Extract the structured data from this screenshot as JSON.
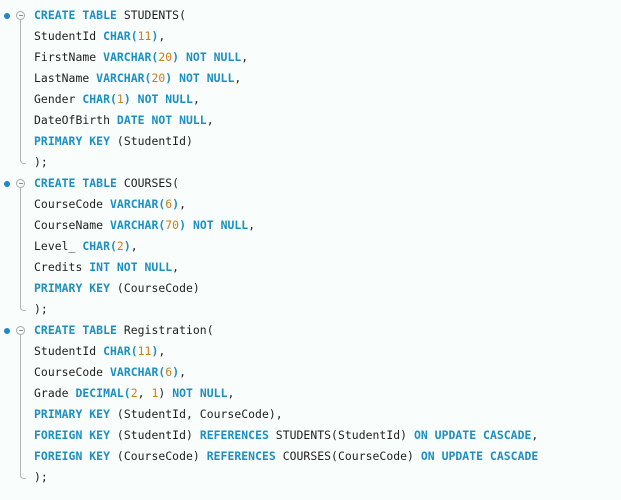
{
  "editor": {
    "language": "SQL",
    "colors": {
      "keyword": "#1b8fc1",
      "number": "#c77d1c",
      "identifier": "#1e1e1e",
      "background": "#f9fefd",
      "breakpoint_dot": "#1f86c9"
    },
    "blocks": [
      {
        "name": "students",
        "lines": [
          [
            {
              "t": "kw",
              "v": "CREATE TABLE"
            },
            {
              "t": "id",
              "v": " STUDENTS("
            }
          ],
          [
            {
              "t": "id",
              "v": "StudentId "
            },
            {
              "t": "kw",
              "v": "CHAR("
            },
            {
              "t": "num",
              "v": "11"
            },
            {
              "t": "kw",
              "v": ")"
            },
            {
              "t": "id",
              "v": ","
            }
          ],
          [
            {
              "t": "id",
              "v": "FirstName "
            },
            {
              "t": "kw",
              "v": "VARCHAR("
            },
            {
              "t": "num",
              "v": "20"
            },
            {
              "t": "kw",
              "v": ")"
            },
            {
              "t": "id",
              "v": " "
            },
            {
              "t": "kw",
              "v": "NOT NULL"
            },
            {
              "t": "id",
              "v": ","
            }
          ],
          [
            {
              "t": "id",
              "v": "LastName "
            },
            {
              "t": "kw",
              "v": "VARCHAR("
            },
            {
              "t": "num",
              "v": "20"
            },
            {
              "t": "kw",
              "v": ")"
            },
            {
              "t": "id",
              "v": " "
            },
            {
              "t": "kw",
              "v": "NOT NULL"
            },
            {
              "t": "id",
              "v": ","
            }
          ],
          [
            {
              "t": "id",
              "v": "Gender "
            },
            {
              "t": "kw",
              "v": "CHAR("
            },
            {
              "t": "num",
              "v": "1"
            },
            {
              "t": "kw",
              "v": ")"
            },
            {
              "t": "id",
              "v": " "
            },
            {
              "t": "kw",
              "v": "NOT NULL"
            },
            {
              "t": "id",
              "v": ","
            }
          ],
          [
            {
              "t": "id",
              "v": "DateOfBirth "
            },
            {
              "t": "kw",
              "v": "DATE NOT NULL"
            },
            {
              "t": "id",
              "v": ","
            }
          ],
          [
            {
              "t": "kw",
              "v": "PRIMARY KEY"
            },
            {
              "t": "id",
              "v": " (StudentId)"
            }
          ],
          [
            {
              "t": "id",
              "v": ");"
            }
          ]
        ]
      },
      {
        "name": "courses",
        "lines": [
          [
            {
              "t": "kw",
              "v": "CREATE TABLE"
            },
            {
              "t": "id",
              "v": " COURSES("
            }
          ],
          [
            {
              "t": "id",
              "v": "CourseCode "
            },
            {
              "t": "kw",
              "v": "VARCHAR("
            },
            {
              "t": "num",
              "v": "6"
            },
            {
              "t": "kw",
              "v": ")"
            },
            {
              "t": "id",
              "v": ","
            }
          ],
          [
            {
              "t": "id",
              "v": "CourseName "
            },
            {
              "t": "kw",
              "v": "VARCHAR("
            },
            {
              "t": "num",
              "v": "70"
            },
            {
              "t": "kw",
              "v": ")"
            },
            {
              "t": "id",
              "v": " "
            },
            {
              "t": "kw",
              "v": "NOT NULL"
            },
            {
              "t": "id",
              "v": ","
            }
          ],
          [
            {
              "t": "id",
              "v": "Level_ "
            },
            {
              "t": "kw",
              "v": "CHAR("
            },
            {
              "t": "num",
              "v": "2"
            },
            {
              "t": "kw",
              "v": ")"
            },
            {
              "t": "id",
              "v": ","
            }
          ],
          [
            {
              "t": "id",
              "v": "Credits "
            },
            {
              "t": "kw",
              "v": "INT NOT NULL"
            },
            {
              "t": "id",
              "v": ","
            }
          ],
          [
            {
              "t": "kw",
              "v": "PRIMARY KEY"
            },
            {
              "t": "id",
              "v": " (CourseCode)"
            }
          ],
          [
            {
              "t": "id",
              "v": ");"
            }
          ]
        ]
      },
      {
        "name": "registration",
        "lines": [
          [
            {
              "t": "kw",
              "v": "CREATE TABLE"
            },
            {
              "t": "id",
              "v": " Registration("
            }
          ],
          [
            {
              "t": "id",
              "v": "StudentId "
            },
            {
              "t": "kw",
              "v": "CHAR("
            },
            {
              "t": "num",
              "v": "11"
            },
            {
              "t": "kw",
              "v": ")"
            },
            {
              "t": "id",
              "v": ","
            }
          ],
          [
            {
              "t": "id",
              "v": "CourseCode "
            },
            {
              "t": "kw",
              "v": "VARCHAR("
            },
            {
              "t": "num",
              "v": "6"
            },
            {
              "t": "kw",
              "v": ")"
            },
            {
              "t": "id",
              "v": ","
            }
          ],
          [
            {
              "t": "id",
              "v": "Grade "
            },
            {
              "t": "kw",
              "v": "DECIMAL("
            },
            {
              "t": "num",
              "v": "2"
            },
            {
              "t": "id",
              "v": ", "
            },
            {
              "t": "num",
              "v": "1"
            },
            {
              "t": "id",
              "v": ") "
            },
            {
              "t": "kw",
              "v": "NOT NULL"
            },
            {
              "t": "id",
              "v": ","
            }
          ],
          [
            {
              "t": "kw",
              "v": "PRIMARY KEY"
            },
            {
              "t": "id",
              "v": " (StudentId, CourseCode),"
            }
          ],
          [
            {
              "t": "kw",
              "v": "FOREIGN KEY"
            },
            {
              "t": "id",
              "v": " (StudentId) "
            },
            {
              "t": "kw",
              "v": "REFERENCES"
            },
            {
              "t": "id",
              "v": " STUDENTS(StudentId) "
            },
            {
              "t": "kw",
              "v": "ON UPDATE CASCADE"
            },
            {
              "t": "id",
              "v": ","
            }
          ],
          [
            {
              "t": "kw",
              "v": "FOREIGN KEY"
            },
            {
              "t": "id",
              "v": " (CourseCode) "
            },
            {
              "t": "kw",
              "v": "REFERENCES"
            },
            {
              "t": "id",
              "v": " COURSES(CourseCode) "
            },
            {
              "t": "kw",
              "v": "ON UPDATE CASCADE"
            }
          ],
          [
            {
              "t": "id",
              "v": ");"
            }
          ]
        ]
      }
    ]
  }
}
